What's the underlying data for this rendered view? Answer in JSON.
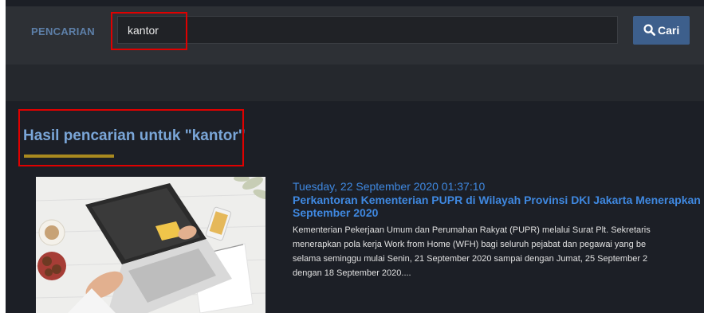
{
  "search": {
    "label": "PENCARIAN",
    "query": "kantor",
    "button_label": "Cari",
    "button_icon": "search-icon"
  },
  "results": {
    "heading": "Hasil pencarian untuk \"kantor\"",
    "items": [
      {
        "date": "Tuesday, 22 September 2020 01:37:10",
        "title_line1": "Perkantoran Kementerian PUPR di Wilayah Provinsi DKI Jakarta Menerapkan",
        "title_line2": "September 2020",
        "excerpt_lines": [
          "Kementerian Pekerjaan Umum dan Perumahan Rakyat (PUPR) melalui Surat Plt. Sekretaris",
          "menerapkan pola kerja Work from Home (WFH) bagi seluruh pejabat dan pegawai yang be",
          "selama seminggu mulai Senin, 21 September 2020 sampai dengan Jumat, 25 September 2",
          "dengan 18 September 2020...."
        ]
      }
    ]
  },
  "colors": {
    "accent_link": "#3f88e0",
    "heading": "#7aa6d8",
    "underline": "#a98a1f",
    "button": "#3d5f8c",
    "highlight": "#e00000"
  }
}
